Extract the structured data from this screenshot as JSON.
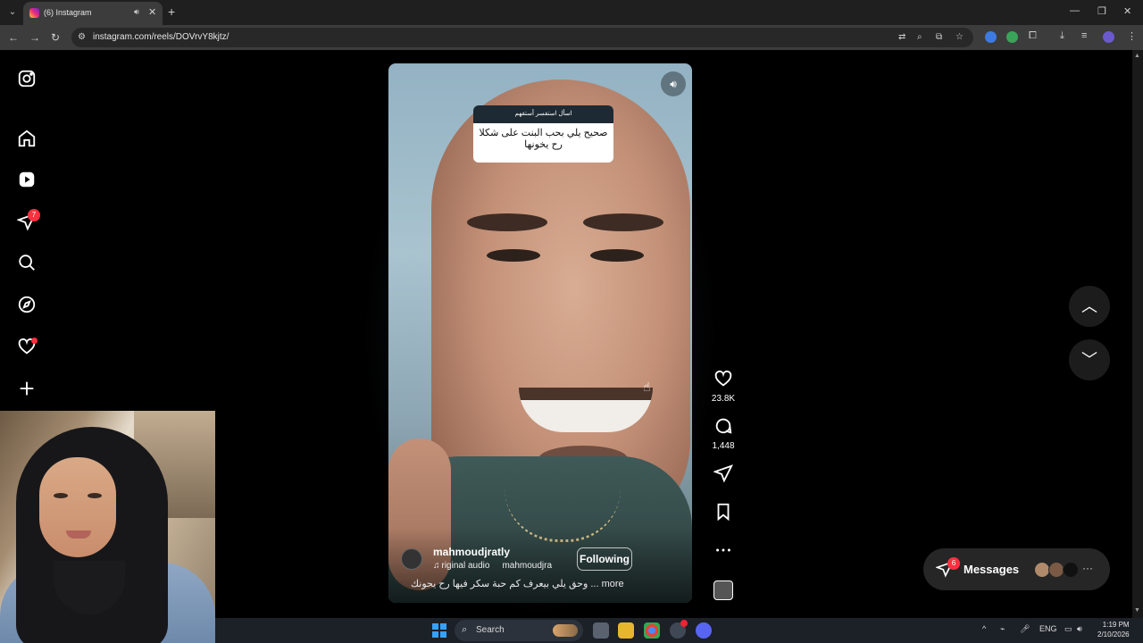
{
  "browser": {
    "tab_title": "(6) Instagram",
    "url": "instagram.com/reels/DOVrvY8kjtz/",
    "tab_list_icon": "chevron-down-icon",
    "audio_icon": "speaker-icon",
    "close_icon": "close-icon",
    "new_tab_icon": "plus-icon"
  },
  "sidebar": {
    "notifications_badge": "7",
    "items": [
      "instagram-logo",
      "home",
      "reels",
      "messages",
      "search",
      "explore",
      "notifications",
      "create"
    ]
  },
  "reel": {
    "sticker_header": "اسأل استفسر أستفهم",
    "sticker_text": "صحيح يلي بحب البنت على شكلا رح يخونها",
    "username": "mahmoudjratly",
    "audio_label": "riginal audio",
    "audio_account": "mahmoudjra",
    "follow_label": "Following",
    "caption": "وحق يلي بيعرف كم حبة سكر فيها رح يحونك ... more"
  },
  "actions": {
    "likes": "23.8K",
    "comments": "1,448"
  },
  "messages": {
    "label": "Messages",
    "badge": "6"
  },
  "taskbar": {
    "search_label": "Search",
    "lang": "ENG",
    "time": "1:19 PM",
    "date": "2/10/2026",
    "discord_badge": "9+"
  },
  "colors": {
    "accent_badge": "#ff3040",
    "chrome_dark": "#1f1f1f",
    "toolbar": "#3c3c3c",
    "taskbar": "#1c2027"
  }
}
